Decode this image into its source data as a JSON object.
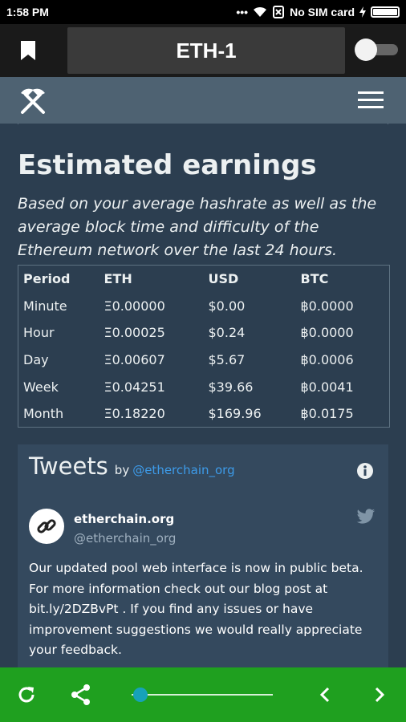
{
  "status_bar": {
    "time": "1:58 PM",
    "dots": "•••",
    "no_sim": "No SIM card"
  },
  "app_bar": {
    "title": "ETH-1"
  },
  "earnings": {
    "title": "Estimated earnings",
    "description": "Based on your average hashrate as well as the average block time and difficulty of the Ethereum network over the last 24 hours.",
    "headers": [
      "Period",
      "ETH",
      "USD",
      "BTC"
    ],
    "rows": [
      [
        "Minute",
        "Ξ0.00000",
        "$0.00",
        "฿0.0000"
      ],
      [
        "Hour",
        "Ξ0.00025",
        "$0.24",
        "฿0.0000"
      ],
      [
        "Day",
        "Ξ0.00607",
        "$5.67",
        "฿0.0006"
      ],
      [
        "Week",
        "Ξ0.04251",
        "$39.66",
        "฿0.0041"
      ],
      [
        "Month",
        "Ξ0.18220",
        "$169.96",
        "฿0.0175"
      ]
    ]
  },
  "tweets": {
    "title": "Tweets",
    "by": "by",
    "handle_link": "@etherchain_org",
    "author_name": "etherchain.org",
    "author_handle": "@etherchain_org",
    "text": "Our updated pool web interface is now in public beta. For more information check out our blog post at bit.ly/2DZBvPt . If you find any issues or have improvement suggestions we would really appreciate your feedback."
  },
  "bottom_bar": {
    "progress": 0.02
  },
  "colors": {
    "bottom_bar": "#1fa01f",
    "link": "#3d9be9",
    "page_bg": "#2c3e50",
    "nav_bg": "#4e6272"
  }
}
